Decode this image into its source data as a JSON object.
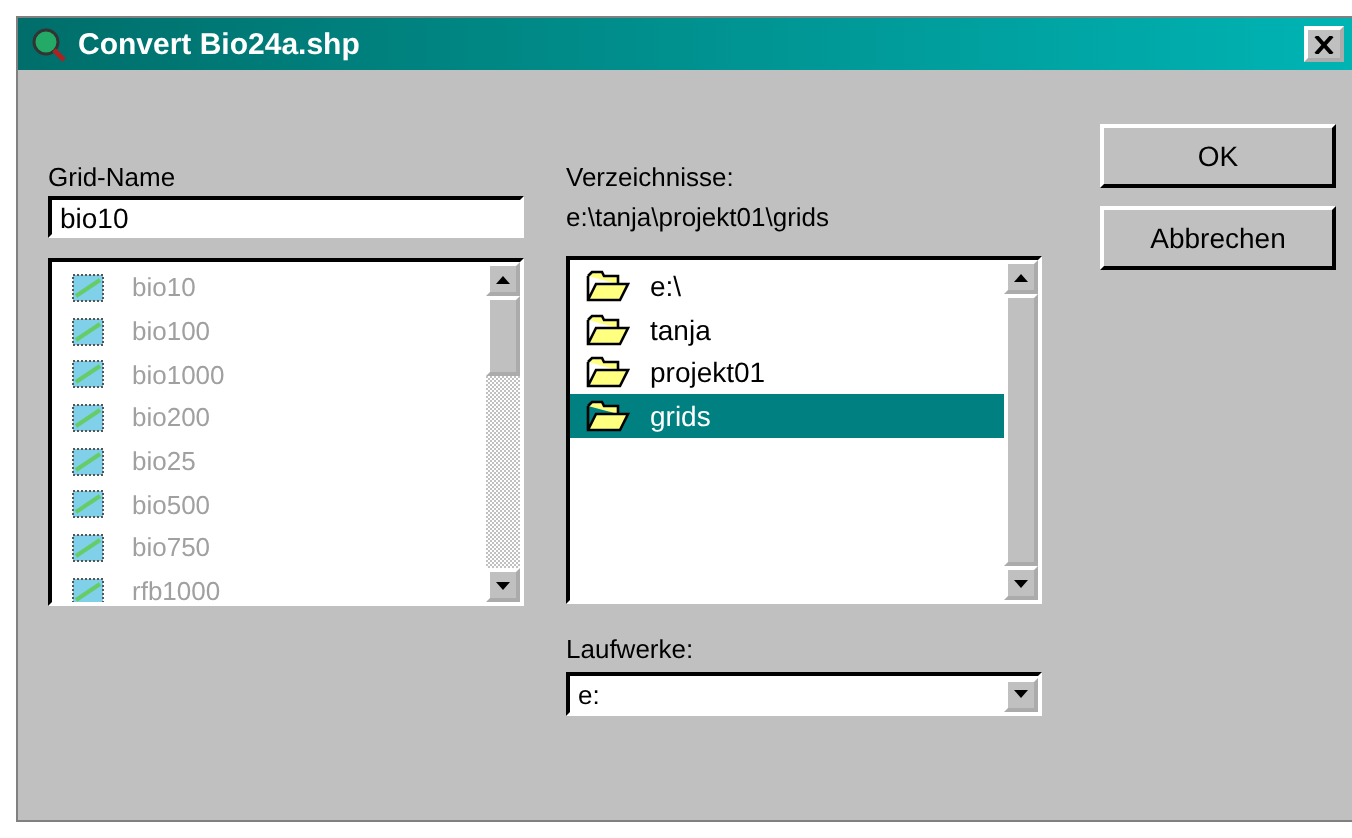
{
  "window": {
    "title": "Convert Bio24a.shp"
  },
  "grid_name": {
    "label": "Grid-Name",
    "value": "bio10"
  },
  "grids": [
    {
      "name": "bio10",
      "disabled": true
    },
    {
      "name": "bio100",
      "disabled": true
    },
    {
      "name": "bio1000",
      "disabled": true
    },
    {
      "name": "bio200",
      "disabled": true
    },
    {
      "name": "bio25",
      "disabled": true
    },
    {
      "name": "bio500",
      "disabled": true
    },
    {
      "name": "bio750",
      "disabled": true
    },
    {
      "name": "rfb1000",
      "disabled": true
    }
  ],
  "directories": {
    "label": "Verzeichnisse:",
    "path": "e:\\tanja\\projekt01\\grids",
    "items": [
      {
        "name": "e:\\",
        "selected": false
      },
      {
        "name": "tanja",
        "selected": false
      },
      {
        "name": "projekt01",
        "selected": false
      },
      {
        "name": "grids",
        "selected": true
      }
    ]
  },
  "drives": {
    "label": "Laufwerke:",
    "value": "e:"
  },
  "buttons": [
    "OK",
    "Abbrechen"
  ]
}
